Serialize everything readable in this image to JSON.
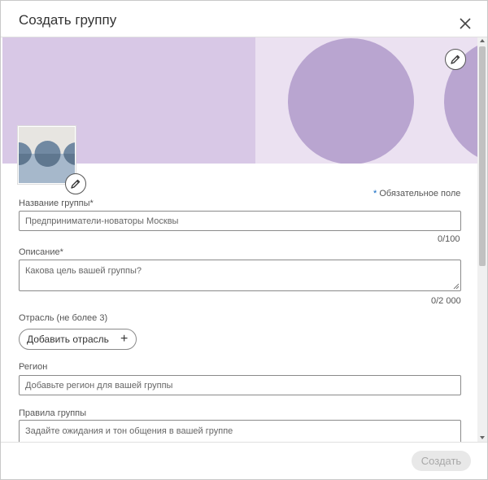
{
  "dialog": {
    "title": "Создать группу",
    "close_icon": "close-icon",
    "banner_edit_icon": "pencil-icon",
    "logo_edit_icon": "pencil-icon"
  },
  "form": {
    "required_note_star": "*",
    "required_note": "Обязательное поле",
    "name": {
      "label": "Название группы",
      "required_mark": "*",
      "placeholder": "Предприниматели-новаторы Москвы",
      "counter": "0/100"
    },
    "description": {
      "label": "Описание",
      "required_mark": "*",
      "placeholder": "Какова цель вашей группы?",
      "counter": "0/2 000"
    },
    "industry": {
      "label": "Отрасль (не более 3)",
      "button_label": "Добавить отрасль",
      "button_icon": "plus-icon",
      "plus_glyph": "+"
    },
    "region": {
      "label": "Регион",
      "placeholder": "Добавьте регион для вашей группы"
    },
    "rules": {
      "label": "Правила группы",
      "placeholder": "Задайте ожидания и тон общения в вашей группе"
    }
  },
  "footer": {
    "create_label": "Создать"
  },
  "colors": {
    "banner_left": "#d8c8e6",
    "banner_right": "#ebe1f1",
    "banner_circle": "#b9a5d0",
    "accent": "#0a66c2",
    "disabled_button_bg": "#e8e8e8",
    "disabled_button_text": "#a8a8a8"
  }
}
